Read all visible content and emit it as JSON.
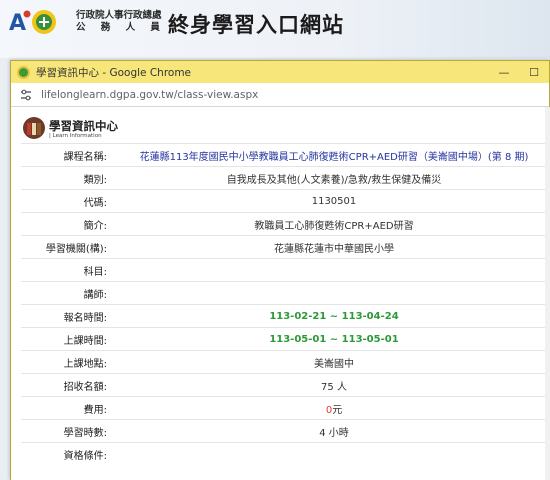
{
  "banner": {
    "agency_line1": "行政院人事行政總處",
    "agency_line2": "公 務 人 員",
    "site_title": "終身學習入口網站"
  },
  "window": {
    "title": "學習資訊中心 - Google Chrome",
    "minimize": "—",
    "maximize": "☐",
    "url": "lifelonglearn.dgpa.gov.tw/class-view.aspx"
  },
  "page_header": {
    "title": "學習資訊中心",
    "subtitle": "| Learn Information"
  },
  "course": {
    "rows": [
      {
        "label": "課程名稱:",
        "value": "花蓮縣113年度國民中小學教職員工心肺復甦術CPR+AED研習（美崙國中場）(第 8 期)",
        "style": "blue"
      },
      {
        "label": "類別:",
        "value": "自我成長及其他(人文素養)/急救/救生保健及備災",
        "style": ""
      },
      {
        "label": "代碼:",
        "value": "1130501",
        "style": ""
      },
      {
        "label": "簡介:",
        "value": "教職員工心肺復甦術CPR+AED研習",
        "style": ""
      },
      {
        "label": "學習機關(構):",
        "value": "花蓮縣花蓮市中華國民小學",
        "style": ""
      },
      {
        "label": "科目:",
        "value": "",
        "style": ""
      },
      {
        "label": "講師:",
        "value": "",
        "style": ""
      },
      {
        "label": "報名時間:",
        "value": "113-02-21 ~ 113-04-24",
        "style": "green"
      },
      {
        "label": "上課時間:",
        "value": "113-05-01 ~ 113-05-01",
        "style": "green"
      },
      {
        "label": "上課地點:",
        "value": "美崙國中",
        "style": ""
      },
      {
        "label": "招收名額:",
        "value": "75 人",
        "style": ""
      },
      {
        "label": "費用:",
        "value": "元",
        "fee": "0",
        "style": "fee"
      },
      {
        "label": "學習時數:",
        "value": "4 小時",
        "style": ""
      },
      {
        "label": "資格條件:",
        "value": "",
        "style": ""
      }
    ]
  },
  "colors": {
    "titlebar": "#f7e77a",
    "link_blue": "#2535a0",
    "date_green": "#2c9a38",
    "fee_red": "#e03b2b"
  }
}
